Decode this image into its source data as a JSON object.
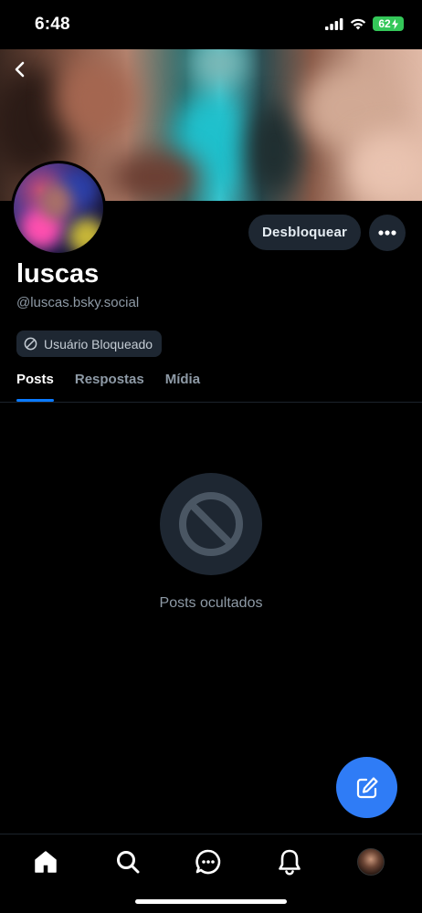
{
  "status_bar": {
    "time": "6:48",
    "battery": "62"
  },
  "header": {
    "back_icon": "chevron-left-icon"
  },
  "profile": {
    "display_name": "luscas",
    "handle": "@luscas.bsky.social",
    "unblock_label": "Desbloquear",
    "more_icon": "ellipsis-icon",
    "blocked_badge": "Usuário Bloqueado"
  },
  "tabs": [
    {
      "label": "Posts",
      "active": true
    },
    {
      "label": "Respostas",
      "active": false
    },
    {
      "label": "Mídia",
      "active": false
    }
  ],
  "empty_state": {
    "icon": "block-icon",
    "message": "Posts ocultados"
  },
  "compose": {
    "icon": "compose-icon"
  },
  "bottom_nav": [
    "home-icon",
    "search-icon",
    "chat-icon",
    "bell-icon",
    "avatar"
  ],
  "colors": {
    "background": "#000000",
    "accent": "#0a7aff",
    "fab": "#2f7cf6",
    "button_bg": "#1e2732",
    "muted_text": "#8e9aa6",
    "battery": "#34c759"
  }
}
